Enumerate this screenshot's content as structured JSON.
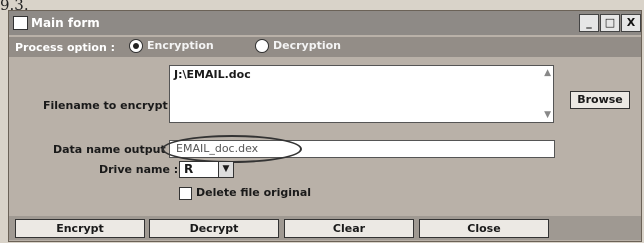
{
  "caption": "9.3.",
  "window": {
    "title": "Main form",
    "controls": [
      "_",
      "□",
      "X"
    ]
  },
  "process": {
    "label": "Process option :",
    "options": [
      {
        "label": "Encryption",
        "selected": true
      },
      {
        "label": "Decryption",
        "selected": false
      }
    ]
  },
  "filename": {
    "label": "Filename to encrypt :",
    "value": "J:\\EMAIL.doc"
  },
  "browse_label": "Browse",
  "output": {
    "label": "Data name output",
    "value": "EMAIL_doc.dex"
  },
  "drive": {
    "label": "Drive name :",
    "value": "R",
    "arrow": "▼"
  },
  "delete_label": "Delete file original",
  "buttons": {
    "encrypt": "Encrypt",
    "decrypt": "Decrypt",
    "clear": "Clear",
    "close": "Close"
  }
}
